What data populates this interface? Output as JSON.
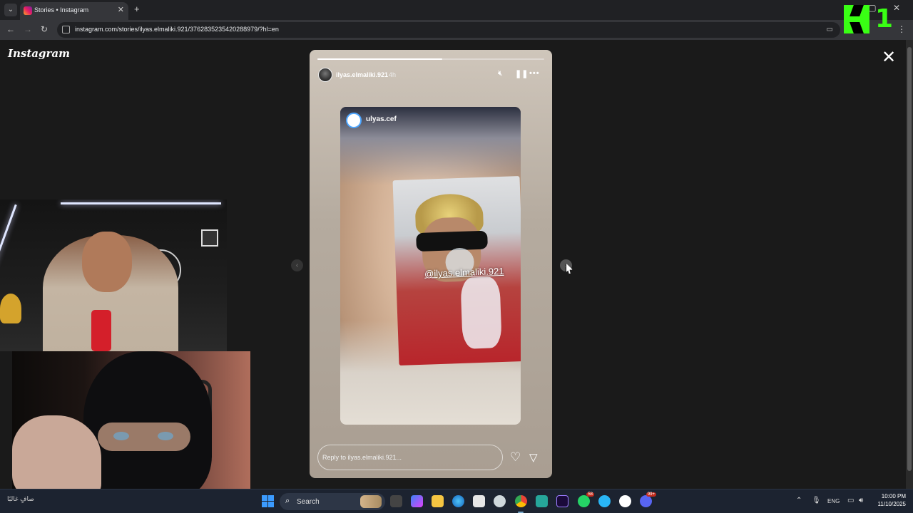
{
  "browser": {
    "tab_title": "Stories • Instagram",
    "url": "instagram.com/stories/ilyas.elmaliki.921/3762835235420288979/?hl=en",
    "new_tab_symbol": "+",
    "window_controls": "– ▢ ✕"
  },
  "overlay_logo": {
    "letter": "K",
    "digit": "1",
    "color": "#39ff14"
  },
  "instagram": {
    "logo_text": "Instagram",
    "story": {
      "username": "ilyas.elmaliki.921",
      "time_ago": "4h",
      "progress": 0.55,
      "reposted_username": "ulyas.cef",
      "mention_tag": "@ilyas.elmaliki.921",
      "reply_placeholder": "Reply to ilyas.elmaliki.921...",
      "icons": [
        "mute-icon",
        "pause-icon",
        "more-icon",
        "heart-icon",
        "send-icon"
      ]
    }
  },
  "taskbar": {
    "weather_text": "صافٍ غالبًا",
    "search_label": "Search",
    "language": "ENG",
    "time": "10:00 PM",
    "date": "11/10/2025",
    "whatsapp_badge": "58",
    "discord_badge": "99+",
    "accent": "#3b9bff"
  }
}
